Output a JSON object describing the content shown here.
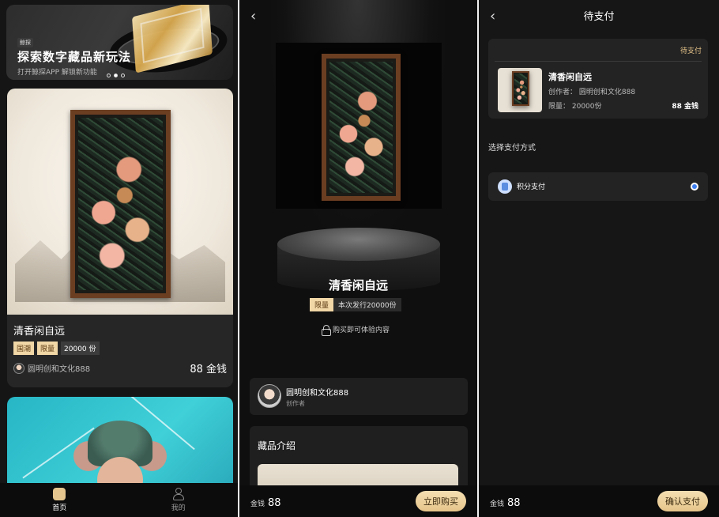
{
  "home": {
    "banner": {
      "tag": "鲸探",
      "title": "探索数字藏品新玩法",
      "subtitle": "打开鲸探APP 解锁新功能",
      "active_dot": 2
    },
    "card": {
      "name": "清香闲自远",
      "badge_hot": "国潮",
      "badge_limited": "限量",
      "quantity": "20000 份",
      "creator": "圆明创和文化888",
      "price": "88 金钱"
    },
    "tabs": [
      {
        "label": "首页",
        "icon": "home-icon",
        "active": true
      },
      {
        "label": "我的",
        "icon": "profile-icon",
        "active": false
      }
    ]
  },
  "detail": {
    "back_icon": "chevron-left-icon",
    "name": "清香闲自远",
    "badge_limited": "限量",
    "issue_text": "本次发行20000份",
    "unlock_text": "购买即可体验内容",
    "creator_name": "圆明创和文化888",
    "creator_role": "创作者",
    "intro_title": "藏品介绍",
    "money_label": "金钱",
    "money_value": "88",
    "buy_button": "立即购买"
  },
  "payment": {
    "back_icon": "chevron-left-icon",
    "title": "待支付",
    "status": "待支付",
    "item_name": "清香闲自远",
    "creator_line": "创作者： 圆明创和文化888",
    "limit_line": "限量： 20000份",
    "item_price": "88 金钱",
    "choose_label": "选择支付方式",
    "method_name": "积分支付",
    "method_selected": true,
    "money_label": "金钱",
    "money_value": "88",
    "confirm_button": "确认支付"
  },
  "colors": {
    "accent_gold": "#e6c48a",
    "badge_bg": "#f1d6a6",
    "radio_blue": "#3d7ef0"
  }
}
